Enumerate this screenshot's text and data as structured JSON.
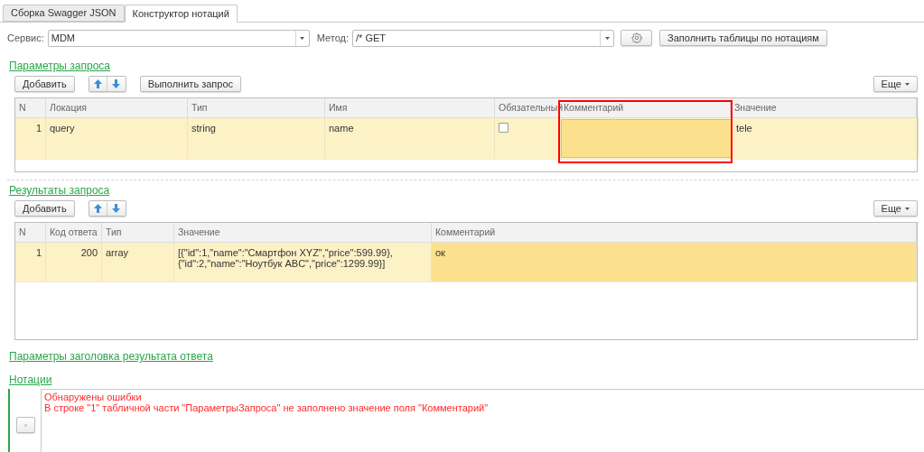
{
  "tabs": [
    {
      "label": "Сборка Swagger JSON",
      "selected": false
    },
    {
      "label": "Конструктор нотаций",
      "selected": true
    }
  ],
  "service": {
    "label": "Сервис:",
    "value": "MDM"
  },
  "method": {
    "label": "Метод:",
    "value": "/* GET"
  },
  "fill_button": "Заполнить таблицы по нотациям",
  "request_params": {
    "title": "Параметры запроса",
    "add_button": "Добавить",
    "run_button": "Выполнить запрос",
    "more_button": "Еще",
    "columns": [
      {
        "label": "N",
        "highlighted": false
      },
      {
        "label": "Локация",
        "highlighted": false
      },
      {
        "label": "Тип",
        "highlighted": false
      },
      {
        "label": "Имя",
        "highlighted": false
      },
      {
        "label": "Обязательный",
        "highlighted": false
      },
      {
        "label": "Комментарий",
        "highlighted": true
      },
      {
        "label": "Значение",
        "highlighted": false
      }
    ],
    "rows": [
      {
        "cells": [
          {
            "kind": "text",
            "text": "1",
            "current": false
          },
          {
            "kind": "text",
            "text": "query",
            "current": false
          },
          {
            "kind": "text",
            "text": "string",
            "current": false
          },
          {
            "kind": "text",
            "text": "name",
            "current": false
          },
          {
            "kind": "checkbox",
            "checked": false,
            "current": false
          },
          {
            "kind": "blank",
            "current": true
          },
          {
            "kind": "text",
            "text": "tele",
            "current": false
          }
        ]
      }
    ]
  },
  "results": {
    "title": "Результаты запроса",
    "add_button": "Добавить",
    "more_button": "Еще",
    "columns": [
      {
        "label": "N",
        "highlighted": false
      },
      {
        "label": "Код ответа",
        "highlighted": false
      },
      {
        "label": "Тип",
        "highlighted": false
      },
      {
        "label": "Значение",
        "highlighted": false
      },
      {
        "label": "Комментарий",
        "highlighted": false
      }
    ],
    "rows": [
      {
        "cells": [
          {
            "kind": "text",
            "text": "1",
            "current": false
          },
          {
            "kind": "text",
            "text": "200",
            "current": false
          },
          {
            "kind": "text",
            "text": "array",
            "current": false
          },
          {
            "kind": "text",
            "text": "[{\"id\":1,\"name\":\"Смартфон XYZ\",\"price\":599.99},{\"id\":2,\"name\":\"Ноутбук ABC\",\"price\":1299.99}]",
            "current": false
          },
          {
            "kind": "text",
            "text": "ок",
            "current": true
          }
        ]
      }
    ]
  },
  "header_params": {
    "title": "Параметры заголовка результата ответа"
  },
  "notations": {
    "title": "Нотации",
    "lines": [
      "Обнаружены ошибки",
      "В строке \"1\" табличной части \"ПараметрыЗапроса\" не заполнено значение поля \"Комментарий\""
    ]
  }
}
